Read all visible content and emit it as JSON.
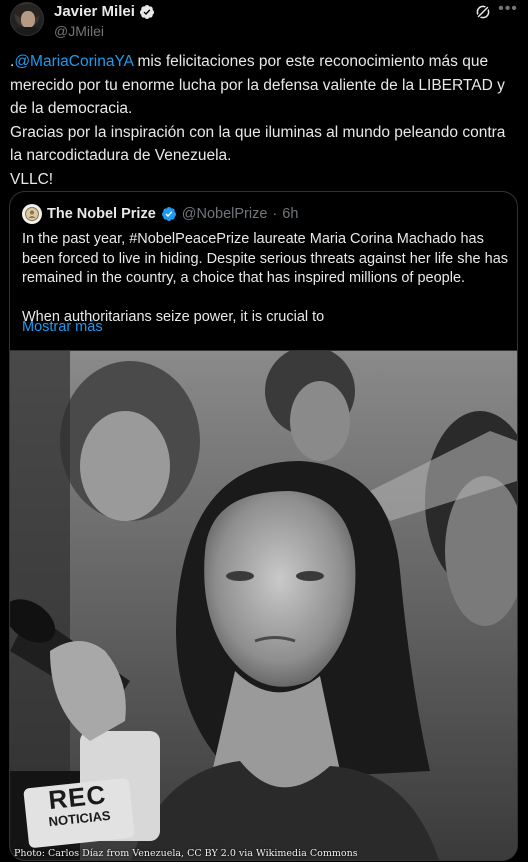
{
  "author": {
    "name": "Javier Milei",
    "handle": "@JMilei",
    "verified": true,
    "avatar_icon": "user-avatar"
  },
  "tweet": {
    "prefix": ".",
    "mention": "@MariaCorinaYA",
    "line1_rest": " mis felicitaciones por este reconocimiento más que merecido por tu enorme lucha por la defensa valiente de la LIBERTAD y de la democracia.",
    "line2": "Gracias por la inspiración con la que iluminas al mundo peleando contra la narcodictadura de Venezuela.",
    "line3": "VLLC!"
  },
  "quote": {
    "name": "The Nobel Prize",
    "handle": "@NobelPrize",
    "separator": "·",
    "time": "6h",
    "paragraph1": "In the past year, #NobelPeacePrize laureate Maria Corina Machado has been forced to live in hiding. Despite serious threats against her life she has remained in the country, a choice that has inspired millions of people.",
    "paragraph2": "When authoritarians seize power, it is crucial to",
    "show_more": "Mostrar más",
    "photo_caption": "Photo: Carlos Díaz from Venezuela, CC BY 2.0 via Wikimedia Commons",
    "mic_logo_line1": "REC",
    "mic_logo_line2": "NOTICIAS"
  },
  "colors": {
    "background": "#000000",
    "text": "#e7e9ea",
    "secondary": "#71767b",
    "link": "#1d9bf0",
    "border": "#2f3336",
    "verified": "#1d9bf0"
  }
}
